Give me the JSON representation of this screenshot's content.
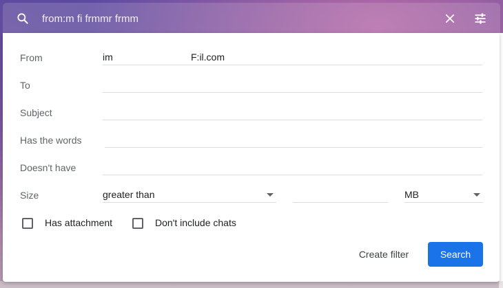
{
  "search": {
    "query": "from:m  fi  frmmr  frmm",
    "icons": {
      "search": "search-icon",
      "close": "close-icon",
      "options": "tune-icon"
    }
  },
  "filter": {
    "from_label": "From",
    "from_value_part1": "im",
    "from_value_part2": "F:il.com",
    "to_label": "To",
    "subject_label": "Subject",
    "has_words_label": "Has the words",
    "doesnt_have_label": "Doesn't have",
    "size_label": "Size",
    "size_comparator": "greater than",
    "size_value": "",
    "size_unit": "MB",
    "has_attachment_label": "Has attachment",
    "dont_include_chats_label": "Don't include chats",
    "create_filter_label": "Create filter",
    "search_label": "Search"
  },
  "colors": {
    "primary": "#1a73e8",
    "label": "#5f6368",
    "text": "#202124"
  }
}
